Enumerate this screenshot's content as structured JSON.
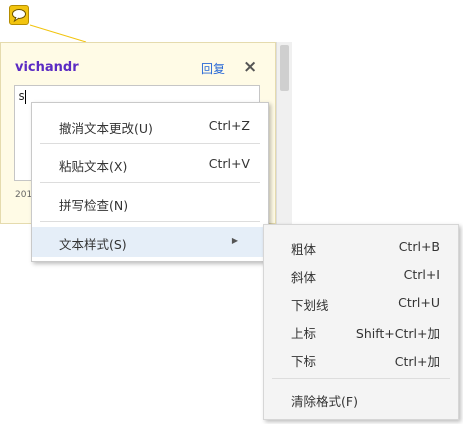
{
  "note": {
    "author": "vichandr",
    "reply_label": "回复",
    "close_label": "×",
    "text_value": "s",
    "timestamp": "201"
  },
  "context_menu": {
    "items": [
      {
        "label": "撤消文本更改(U)",
        "shortcut": "Ctrl+Z"
      },
      {
        "label": "粘贴文本(X)",
        "shortcut": "Ctrl+V"
      },
      {
        "label": "拼写检查(N)",
        "shortcut": ""
      },
      {
        "label": "文本样式(S)",
        "shortcut": ""
      }
    ]
  },
  "submenu": {
    "items": [
      {
        "label": "粗体",
        "shortcut": "Ctrl+B"
      },
      {
        "label": "斜体",
        "shortcut": "Ctrl+I"
      },
      {
        "label": "下划线",
        "shortcut": "Ctrl+U"
      },
      {
        "label": "上标",
        "shortcut": "Shift+Ctrl+加"
      },
      {
        "label": "下标",
        "shortcut": "Ctrl+加"
      },
      {
        "label": "清除格式(F)",
        "shortcut": ""
      }
    ]
  },
  "colors": {
    "note_bg": "#fffbe6",
    "author": "#5b2bc3",
    "reply": "#2a6ad6",
    "icon": "#f2c40f",
    "highlight": "#e5eef8"
  },
  "icons": [
    "comment-icon",
    "close-icon",
    "submenu-arrow-icon"
  ]
}
